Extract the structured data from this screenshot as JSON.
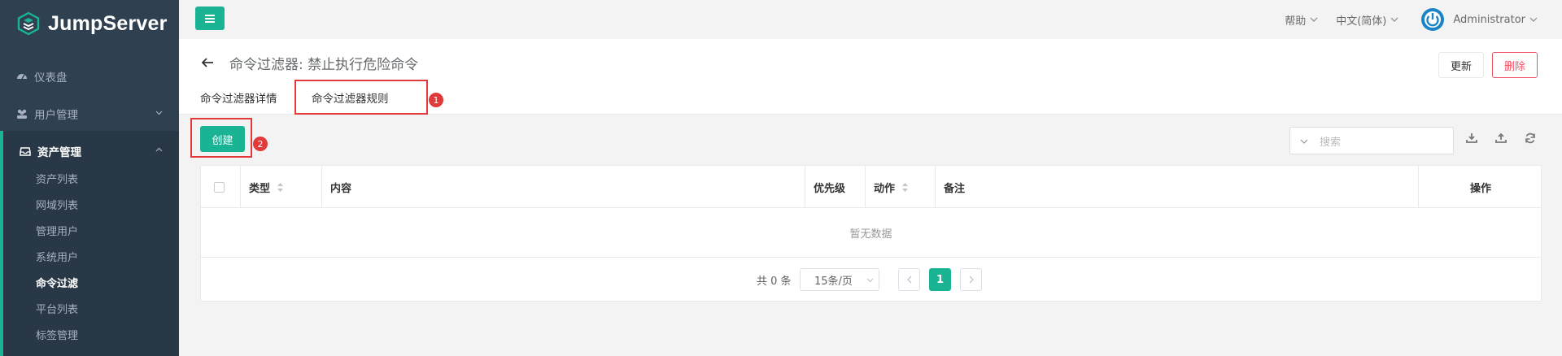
{
  "app": {
    "name": "JumpServer"
  },
  "sidebar": {
    "items": [
      {
        "label": "仪表盘",
        "icon": "dashboard-icon"
      },
      {
        "label": "用户管理",
        "icon": "users-icon"
      },
      {
        "label": "资产管理",
        "icon": "inbox-icon"
      }
    ],
    "subitems": [
      {
        "label": "资产列表"
      },
      {
        "label": "网域列表"
      },
      {
        "label": "管理用户"
      },
      {
        "label": "系统用户"
      },
      {
        "label": "命令过滤"
      },
      {
        "label": "平台列表"
      },
      {
        "label": "标签管理"
      }
    ]
  },
  "topbar": {
    "help": "帮助",
    "language": "中文(简体)",
    "user": "Administrator"
  },
  "page": {
    "title": "命令过滤器: 禁止执行危险命令",
    "update_label": "更新",
    "delete_label": "删除",
    "tabs": [
      {
        "label": "命令过滤器详情"
      },
      {
        "label": "命令过滤器规则"
      }
    ]
  },
  "annotations": {
    "badge1": "1",
    "badge2": "2"
  },
  "toolbar": {
    "create_label": "创建",
    "search_placeholder": "搜索"
  },
  "table": {
    "columns": [
      "类型",
      "内容",
      "优先级",
      "动作",
      "备注",
      "操作"
    ],
    "empty_text": "暂无数据"
  },
  "pagination": {
    "total_text": "共 0 条",
    "page_size": "15条/页",
    "current_page": "1"
  },
  "colors": {
    "accent": "#1ab394",
    "sidebar": "#2f4050",
    "danger": "#ed5565",
    "annotation": "#e03a3a"
  }
}
